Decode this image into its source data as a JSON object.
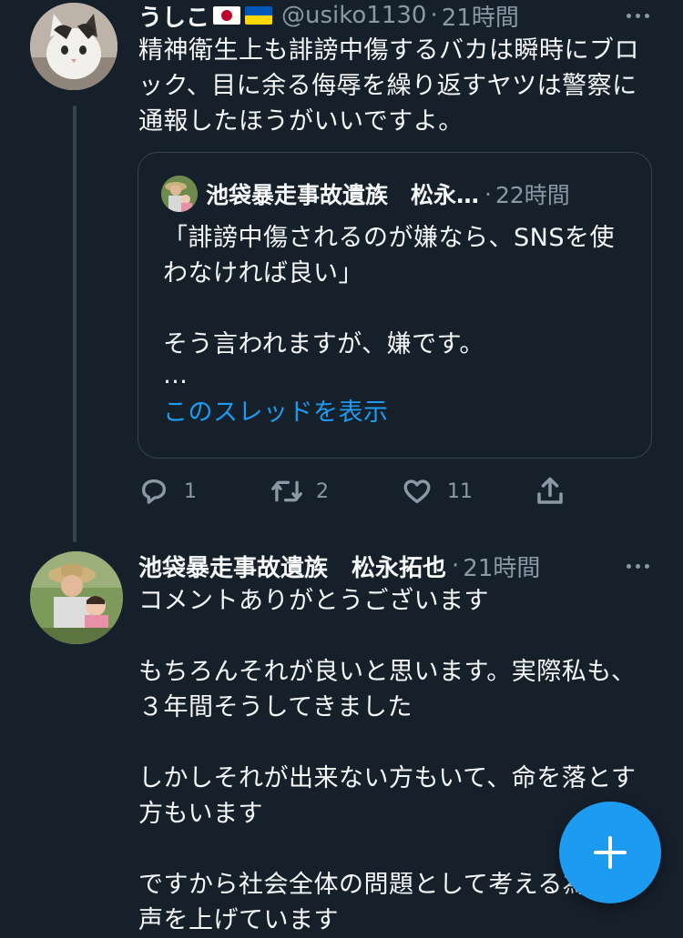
{
  "tweet1": {
    "display_name": "うしこ",
    "flag_jp": "🇯🇵",
    "flag_ua": "🇺🇦",
    "handle": "@usiko1130",
    "separator": "·",
    "time": "21時間",
    "body_lines": [
      "精神衛生上も誹謗中傷するバカは瞬時にブロ",
      "ック、目に余る侮辱を繰り返すヤツは警察に",
      "通報したほうがいいですよ。"
    ],
    "quote": {
      "display_name": "池袋暴走事故遺族　松永…",
      "separator": "·",
      "time": "22時間",
      "body_lines": [
        "「誹謗中傷されるのが嫌なら、SNSを使",
        "わなければ良い」",
        "",
        "そう言われますが、嫌です。",
        "…"
      ],
      "show_thread": "このスレッドを表示"
    },
    "actions": {
      "reply_count": "1",
      "retweet_count": "2",
      "like_count": "11"
    }
  },
  "tweet2": {
    "display_name": "池袋暴走事故遺族　松永拓也",
    "separator": "·",
    "time": "21時間",
    "body_lines": [
      "コメントありがとうございます",
      "",
      "もちろんそれが良いと思います。実際私も、",
      "３年間そうしてきました",
      "",
      "しかしそれが出来ない方もいて、命を落とす",
      "方もいます",
      "",
      "ですから社会全体の問題として考える為に",
      "声を上げています"
    ]
  },
  "colors": {
    "background": "#15202b",
    "text": "#f7f9f9",
    "muted": "#8b98a5",
    "link": "#1d9bf0",
    "border": "#38444d",
    "fab": "#1d9bf0"
  },
  "icons": {
    "more": "more-horizontal-icon",
    "reply": "reply-icon",
    "retweet": "retweet-icon",
    "like": "heart-icon",
    "share": "share-icon",
    "compose": "plus-icon"
  }
}
